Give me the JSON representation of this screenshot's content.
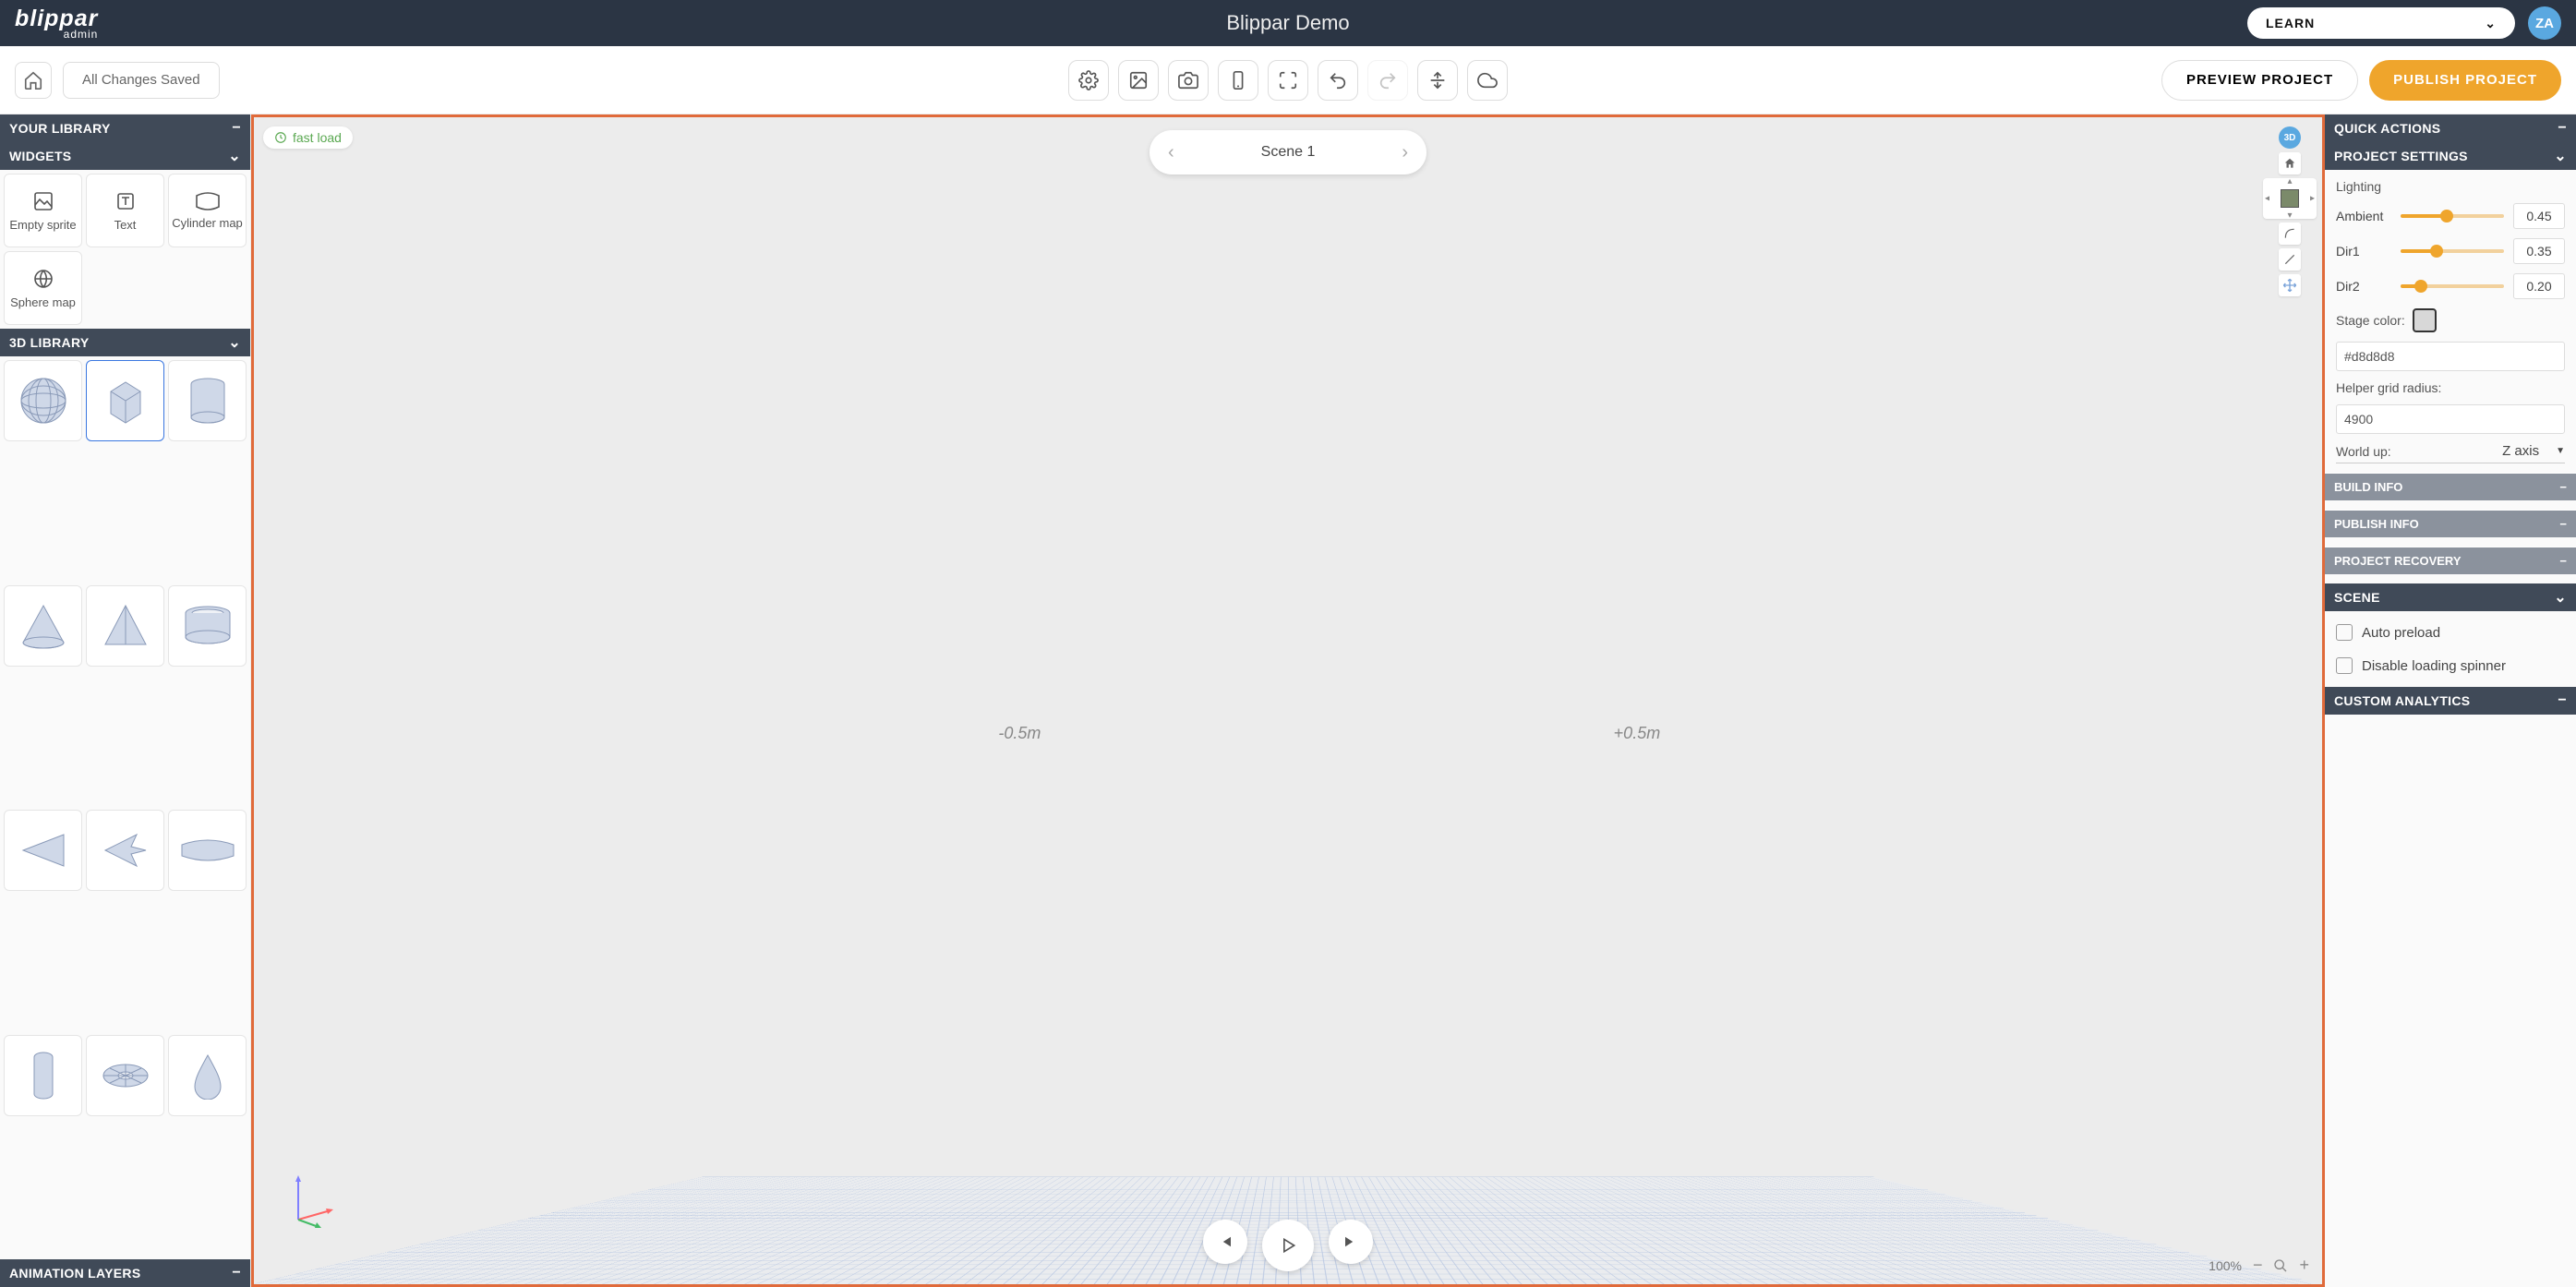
{
  "topbar": {
    "app_name": "blippar",
    "app_sub": "admin",
    "title": "Blippar Demo",
    "learn_label": "LEARN",
    "avatar_initials": "ZA"
  },
  "toolbar": {
    "saved_status": "All Changes Saved",
    "preview_label": "PREVIEW PROJECT",
    "publish_label": "PUBLISH PROJECT"
  },
  "left": {
    "your_library": "YOUR LIBRARY",
    "widgets": "WIDGETS",
    "widget_items": [
      {
        "label": "Empty sprite"
      },
      {
        "label": "Text"
      },
      {
        "label": "Cylinder map"
      },
      {
        "label": "Sphere map"
      }
    ],
    "three_d_library": "3D LIBRARY",
    "animation_layers": "ANIMATION LAYERS"
  },
  "canvas": {
    "fast_load": "fast load",
    "scene_label": "Scene 1",
    "marker_left": "-0.5m",
    "marker_right": "+0.5m",
    "zoom_percent": "100%",
    "tool3d_label": "3D"
  },
  "right": {
    "quick_actions": "QUICK ACTIONS",
    "project_settings": "PROJECT SETTINGS",
    "lighting_label": "Lighting",
    "ambient_label": "Ambient",
    "ambient_val": "0.45",
    "dir1_label": "Dir1",
    "dir1_val": "0.35",
    "dir2_label": "Dir2",
    "dir2_val": "0.20",
    "stage_color_label": "Stage color:",
    "stage_color_val": "#d8d8d8",
    "helper_grid_label": "Helper grid radius:",
    "helper_grid_val": "4900",
    "world_up_label": "World up:",
    "world_up_val": "Z axis",
    "build_info": "BUILD INFO",
    "publish_info": "PUBLISH INFO",
    "project_recovery": "PROJECT RECOVERY",
    "scene": "SCENE",
    "auto_preload": "Auto preload",
    "disable_loading": "Disable loading spinner",
    "custom_analytics": "CUSTOM ANALYTICS"
  }
}
